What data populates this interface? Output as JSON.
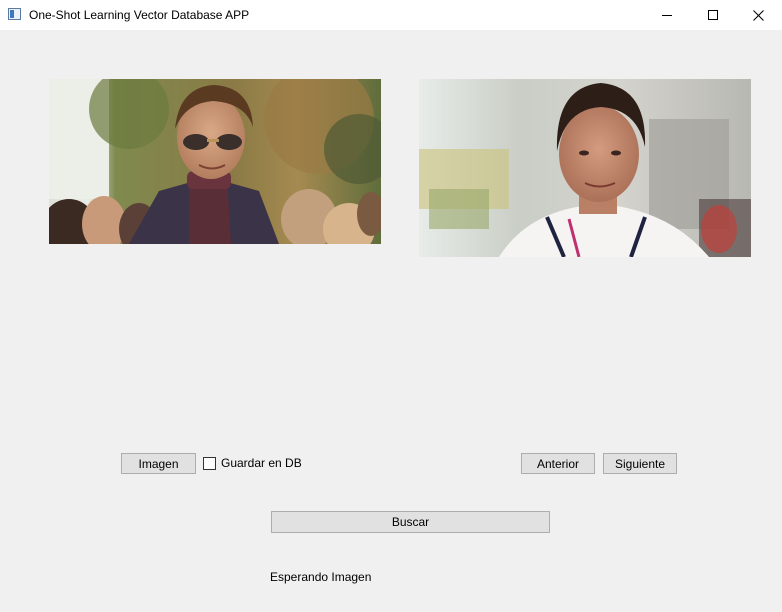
{
  "window": {
    "title": "One-Shot Learning Vector Database APP",
    "controls": [
      "minimize-icon",
      "maximize-icon",
      "close-icon"
    ]
  },
  "images": {
    "left": {
      "description": "query-image"
    },
    "right": {
      "description": "match-image"
    }
  },
  "controls": {
    "image_button_label": "Imagen",
    "save_checkbox_label": "Guardar en DB",
    "save_checkbox_checked": false,
    "previous_button_label": "Anterior",
    "next_button_label": "Siguiente",
    "search_button_label": "Buscar"
  },
  "status": {
    "text": "Esperando Imagen"
  }
}
